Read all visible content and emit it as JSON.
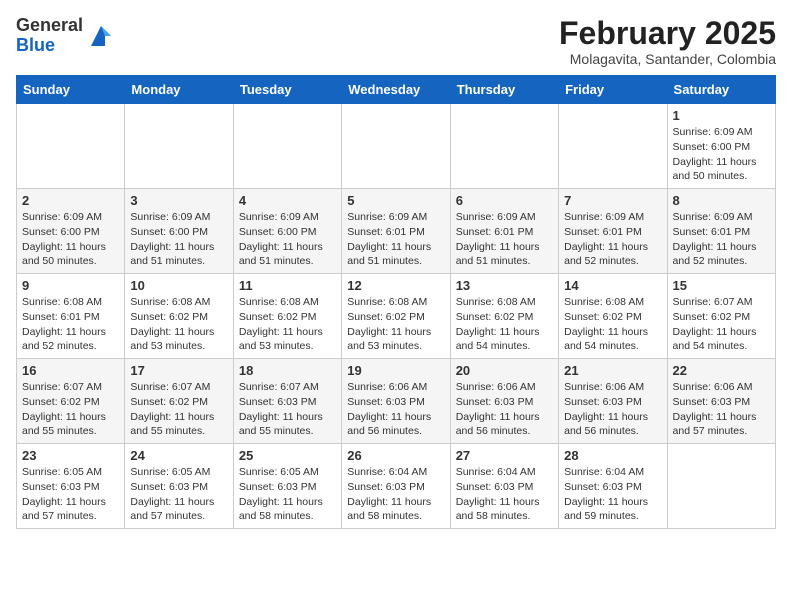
{
  "header": {
    "logo_line1": "General",
    "logo_line2": "Blue",
    "month": "February 2025",
    "location": "Molagavita, Santander, Colombia"
  },
  "days_of_week": [
    "Sunday",
    "Monday",
    "Tuesday",
    "Wednesday",
    "Thursday",
    "Friday",
    "Saturday"
  ],
  "weeks": [
    [
      {
        "day": "",
        "info": ""
      },
      {
        "day": "",
        "info": ""
      },
      {
        "day": "",
        "info": ""
      },
      {
        "day": "",
        "info": ""
      },
      {
        "day": "",
        "info": ""
      },
      {
        "day": "",
        "info": ""
      },
      {
        "day": "1",
        "info": "Sunrise: 6:09 AM\nSunset: 6:00 PM\nDaylight: 11 hours\nand 50 minutes."
      }
    ],
    [
      {
        "day": "2",
        "info": "Sunrise: 6:09 AM\nSunset: 6:00 PM\nDaylight: 11 hours\nand 50 minutes."
      },
      {
        "day": "3",
        "info": "Sunrise: 6:09 AM\nSunset: 6:00 PM\nDaylight: 11 hours\nand 51 minutes."
      },
      {
        "day": "4",
        "info": "Sunrise: 6:09 AM\nSunset: 6:00 PM\nDaylight: 11 hours\nand 51 minutes."
      },
      {
        "day": "5",
        "info": "Sunrise: 6:09 AM\nSunset: 6:01 PM\nDaylight: 11 hours\nand 51 minutes."
      },
      {
        "day": "6",
        "info": "Sunrise: 6:09 AM\nSunset: 6:01 PM\nDaylight: 11 hours\nand 51 minutes."
      },
      {
        "day": "7",
        "info": "Sunrise: 6:09 AM\nSunset: 6:01 PM\nDaylight: 11 hours\nand 52 minutes."
      },
      {
        "day": "8",
        "info": "Sunrise: 6:09 AM\nSunset: 6:01 PM\nDaylight: 11 hours\nand 52 minutes."
      }
    ],
    [
      {
        "day": "9",
        "info": "Sunrise: 6:08 AM\nSunset: 6:01 PM\nDaylight: 11 hours\nand 52 minutes."
      },
      {
        "day": "10",
        "info": "Sunrise: 6:08 AM\nSunset: 6:02 PM\nDaylight: 11 hours\nand 53 minutes."
      },
      {
        "day": "11",
        "info": "Sunrise: 6:08 AM\nSunset: 6:02 PM\nDaylight: 11 hours\nand 53 minutes."
      },
      {
        "day": "12",
        "info": "Sunrise: 6:08 AM\nSunset: 6:02 PM\nDaylight: 11 hours\nand 53 minutes."
      },
      {
        "day": "13",
        "info": "Sunrise: 6:08 AM\nSunset: 6:02 PM\nDaylight: 11 hours\nand 54 minutes."
      },
      {
        "day": "14",
        "info": "Sunrise: 6:08 AM\nSunset: 6:02 PM\nDaylight: 11 hours\nand 54 minutes."
      },
      {
        "day": "15",
        "info": "Sunrise: 6:07 AM\nSunset: 6:02 PM\nDaylight: 11 hours\nand 54 minutes."
      }
    ],
    [
      {
        "day": "16",
        "info": "Sunrise: 6:07 AM\nSunset: 6:02 PM\nDaylight: 11 hours\nand 55 minutes."
      },
      {
        "day": "17",
        "info": "Sunrise: 6:07 AM\nSunset: 6:02 PM\nDaylight: 11 hours\nand 55 minutes."
      },
      {
        "day": "18",
        "info": "Sunrise: 6:07 AM\nSunset: 6:03 PM\nDaylight: 11 hours\nand 55 minutes."
      },
      {
        "day": "19",
        "info": "Sunrise: 6:06 AM\nSunset: 6:03 PM\nDaylight: 11 hours\nand 56 minutes."
      },
      {
        "day": "20",
        "info": "Sunrise: 6:06 AM\nSunset: 6:03 PM\nDaylight: 11 hours\nand 56 minutes."
      },
      {
        "day": "21",
        "info": "Sunrise: 6:06 AM\nSunset: 6:03 PM\nDaylight: 11 hours\nand 56 minutes."
      },
      {
        "day": "22",
        "info": "Sunrise: 6:06 AM\nSunset: 6:03 PM\nDaylight: 11 hours\nand 57 minutes."
      }
    ],
    [
      {
        "day": "23",
        "info": "Sunrise: 6:05 AM\nSunset: 6:03 PM\nDaylight: 11 hours\nand 57 minutes."
      },
      {
        "day": "24",
        "info": "Sunrise: 6:05 AM\nSunset: 6:03 PM\nDaylight: 11 hours\nand 57 minutes."
      },
      {
        "day": "25",
        "info": "Sunrise: 6:05 AM\nSunset: 6:03 PM\nDaylight: 11 hours\nand 58 minutes."
      },
      {
        "day": "26",
        "info": "Sunrise: 6:04 AM\nSunset: 6:03 PM\nDaylight: 11 hours\nand 58 minutes."
      },
      {
        "day": "27",
        "info": "Sunrise: 6:04 AM\nSunset: 6:03 PM\nDaylight: 11 hours\nand 58 minutes."
      },
      {
        "day": "28",
        "info": "Sunrise: 6:04 AM\nSunset: 6:03 PM\nDaylight: 11 hours\nand 59 minutes."
      },
      {
        "day": "",
        "info": ""
      }
    ]
  ]
}
